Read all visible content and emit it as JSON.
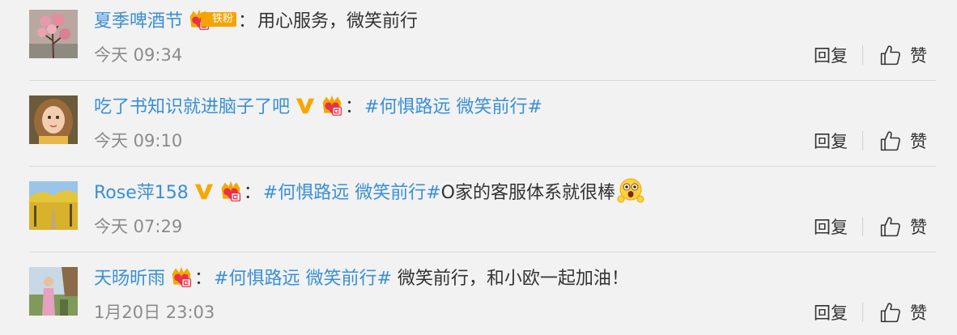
{
  "comments": [
    {
      "username": "夏季啤酒节",
      "separator": "：",
      "fan_badge": "铁粉",
      "hashtag": "",
      "text": "用心服务，微笑前行",
      "time": "今天 09:34",
      "reply_label": "回复",
      "like_label": "赞"
    },
    {
      "username": "吃了书知识就进脑子了吧",
      "separator": "：",
      "hashtag": "#何惧路远 微笑前行#",
      "text": "",
      "time": "今天 09:10",
      "reply_label": "回复",
      "like_label": "赞"
    },
    {
      "username": "Rose萍158",
      "separator": "：",
      "hashtag": "#何惧路远 微笑前行#",
      "text": "O家的客服体系就很棒",
      "time": "今天 07:29",
      "reply_label": "回复",
      "like_label": "赞"
    },
    {
      "username": "天旸昕雨",
      "separator": "：",
      "hashtag": "#何惧路远 微笑前行#",
      "text": " 微笑前行，和小欧一起加油！",
      "time": "1月20日 23:03",
      "reply_label": "回复",
      "like_label": "赞"
    }
  ],
  "colors": {
    "username": "#3a8fd6",
    "text": "#333333",
    "time": "#8b8b8b",
    "verified": "#f5a800",
    "background": "#f2f2f2"
  }
}
